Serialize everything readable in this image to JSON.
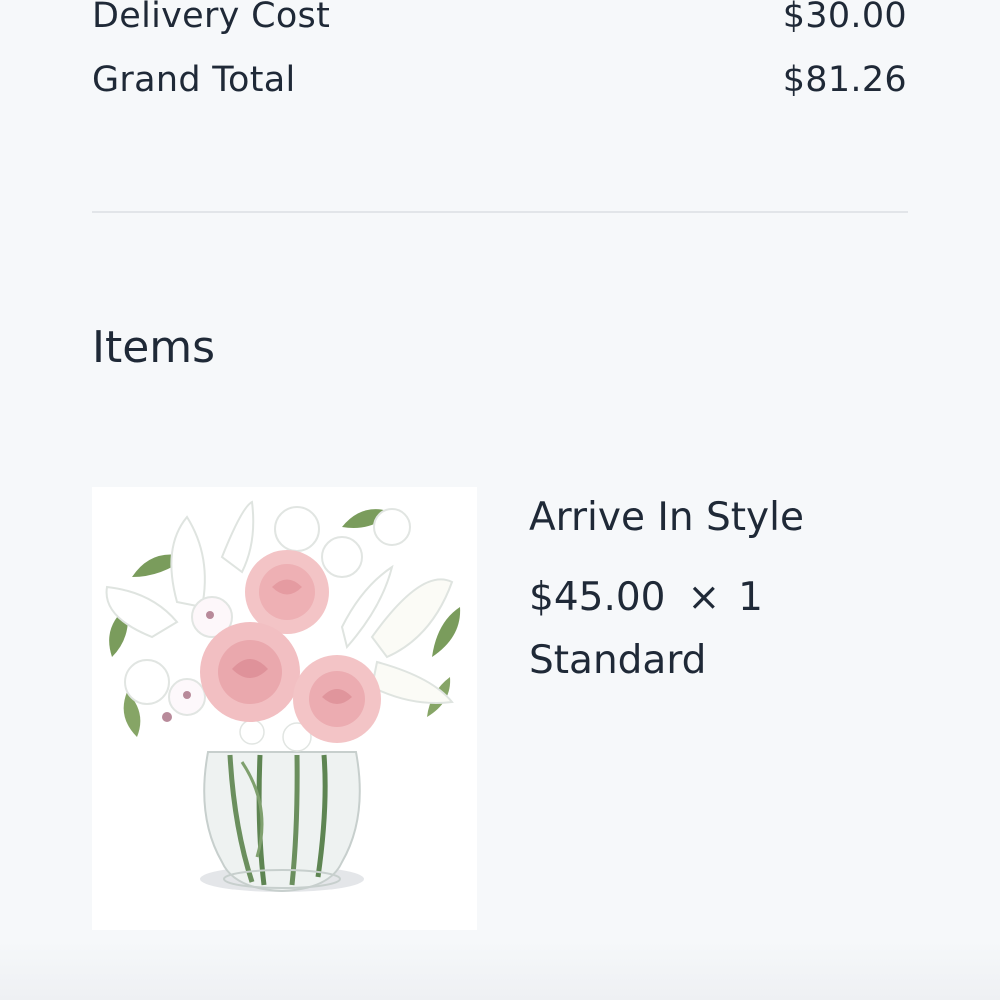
{
  "summary": {
    "delivery_cost": {
      "label": "Delivery Cost",
      "value": "$30.00"
    },
    "grand_total": {
      "label": "Grand Total",
      "value": "$81.26"
    }
  },
  "items_section": {
    "heading": "Items",
    "items": [
      {
        "name": "Arrive In Style",
        "price": "$45.00",
        "multiply_sign": "×",
        "quantity": "1",
        "option": "Standard",
        "image": "flower-bouquet-in-glass-vase"
      }
    ]
  }
}
